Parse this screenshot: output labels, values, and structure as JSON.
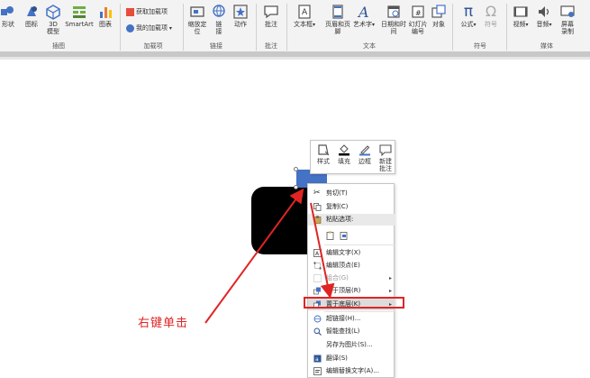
{
  "ribbon": {
    "illustrations": {
      "shapes": "形状",
      "icons": "图标",
      "model3d_line1": "3D",
      "model3d_line2": "模型",
      "smartart": "SmartArt",
      "chart": "图表",
      "group_label": "插图"
    },
    "addins": {
      "get_addins": "获取加载项",
      "my_addins": "我的加载项",
      "group_label": "加载项"
    },
    "links": {
      "zoom_line1": "缩放定",
      "zoom_line2": "位",
      "link_line1": "链",
      "link_line2": "接",
      "action": "动作",
      "group_label": "链接"
    },
    "comments": {
      "comment": "批注",
      "group_label": "批注"
    },
    "text": {
      "textbox": "文本框",
      "header_footer": "页眉和页脚",
      "wordart": "艺术字",
      "datetime": "日期和时间",
      "slide_number_line1": "幻灯片",
      "slide_number_line2": "编号",
      "object": "对象",
      "group_label": "文本"
    },
    "symbols": {
      "equation": "公式",
      "symbol": "符号",
      "group_label": "符号"
    },
    "media": {
      "video": "视频",
      "audio": "音频",
      "screen_rec_line1": "屏幕",
      "screen_rec_line2": "录制",
      "group_label": "媒体"
    }
  },
  "mini_toolbar": {
    "style": "样式",
    "fill": "填充",
    "outline": "边框",
    "new_comment_line1": "新建",
    "new_comment_line2": "批注"
  },
  "context_menu": {
    "items": [
      {
        "label": "剪切(T)"
      },
      {
        "label": "复制(C)"
      },
      {
        "label": "粘贴选项:"
      },
      {
        "label": "编辑文字(X)"
      },
      {
        "label": "编辑顶点(E)"
      },
      {
        "label": "组合(G)"
      },
      {
        "label": "置于顶层(R)"
      },
      {
        "label": "置于底层(K)"
      },
      {
        "label": "超链接(H)..."
      },
      {
        "label": "智能查找(L)"
      },
      {
        "label": "另存为图片(S)..."
      },
      {
        "label": "翻译(S)"
      },
      {
        "label": "编辑替换文字(A)..."
      }
    ]
  },
  "annotation": {
    "text": "右键单击",
    "color": "#e02424"
  },
  "colors": {
    "shape_fill": "#000000",
    "selected_shape": "#4472c4"
  }
}
